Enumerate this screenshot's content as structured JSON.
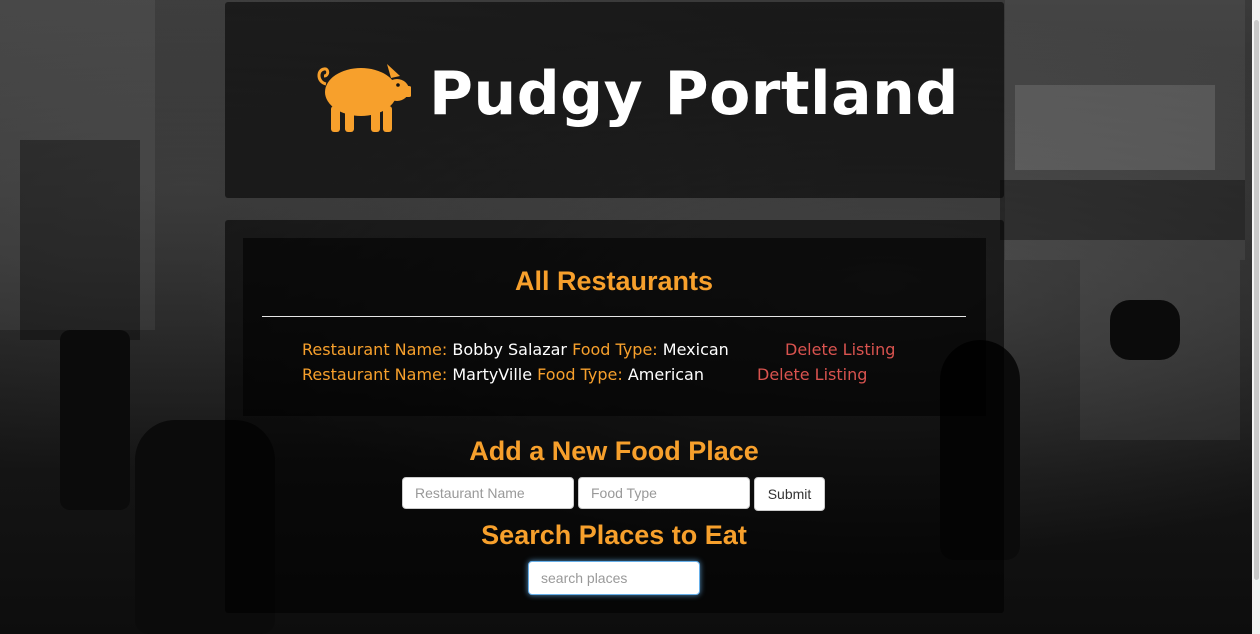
{
  "header": {
    "brand": "Pudgy Portland",
    "logo_icon": "pig-icon"
  },
  "restaurants": {
    "title": "All Restaurants",
    "name_label": "Restaurant Name:",
    "type_label": "Food Type:",
    "delete_label": "Delete Listing",
    "items": [
      {
        "name": "Bobby Salazar",
        "food_type": "Mexican"
      },
      {
        "name": "MartyVille",
        "food_type": "American"
      }
    ]
  },
  "add_form": {
    "title": "Add a New Food Place",
    "name_placeholder": "Restaurant Name",
    "type_placeholder": "Food Type",
    "submit_label": "Submit"
  },
  "search": {
    "title": "Search Places to Eat",
    "placeholder": "search places"
  },
  "colors": {
    "accent": "#f7a02c",
    "delete": "#d9534f",
    "panel": "rgba(0,0,0,0.55)"
  }
}
